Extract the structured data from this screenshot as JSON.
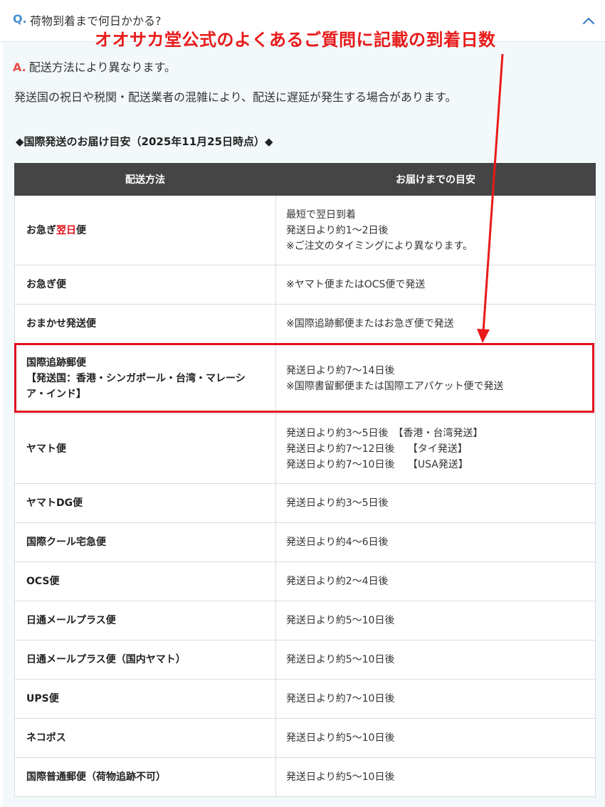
{
  "question": {
    "marker": "Q.",
    "text": "荷物到着まで何日かかる?",
    "toggle_icon": "chevron-up-icon"
  },
  "annotation": {
    "title": "オオサカ堂公式のよくあるご質問に記載の到着日数",
    "color": "#e81a1a"
  },
  "answer": {
    "marker": "A.",
    "text": "配送方法により異なります。",
    "note": "発送国の祝日や税関・配送業者の混雑により、配送に遅延が発生する場合があります。",
    "heading": "◆国際発送のお届け目安（2025年11月25日時点）◆"
  },
  "table": {
    "headers": [
      "配送方法",
      "お届けまでの目安"
    ],
    "rows": [
      {
        "method_parts": [
          "お急ぎ",
          "翌日",
          "便"
        ],
        "estimate": [
          "最短で翌日到着",
          "発送日より約1～2日後",
          "※ご注文のタイミングにより異なります。"
        ]
      },
      {
        "method": "お急ぎ便",
        "estimate": [
          "※ヤマト便またはOCS便で発送"
        ]
      },
      {
        "method": "おまかせ発送便",
        "estimate": [
          "※国際追跡郵便またはお急ぎ便で発送"
        ]
      },
      {
        "method": "国際追跡郵便",
        "method_sub": [
          "【発送国：香港・シンガポール・台湾・マレーシ",
          "ア・インド】"
        ],
        "estimate": [
          "発送日より約7～14日後",
          "※国際書留郵便または国際エアパケット便で発送"
        ],
        "highlighted": true
      },
      {
        "method": "ヤマト便",
        "estimate": [
          "発送日より約3～5日後　【香港・台湾発送】",
          "発送日より約7～12日後　 【タイ発送】",
          "発送日より約7～10日後　 【USA発送】"
        ]
      },
      {
        "method": "ヤマトDG便",
        "estimate": [
          "発送日より約3～5日後"
        ]
      },
      {
        "method": "国際クール宅急便",
        "estimate": [
          "発送日より約4～6日後"
        ]
      },
      {
        "method": "OCS便",
        "estimate": [
          "発送日より約2～4日後"
        ]
      },
      {
        "method": "日通メールプラス便",
        "estimate": [
          "発送日より約5～10日後"
        ]
      },
      {
        "method": "日通メールプラス便（国内ヤマト）",
        "estimate": [
          "発送日より約5～10日後"
        ]
      },
      {
        "method": "UPS便",
        "estimate": [
          "発送日より約7～10日後"
        ]
      },
      {
        "method": "ネコポス",
        "estimate": [
          "発送日より約5～10日後"
        ]
      },
      {
        "method": "国際普通郵便（荷物追跡不可）",
        "estimate": [
          "発送日より約5～10日後"
        ]
      }
    ]
  },
  "colors": {
    "q_marker": "#4a8fd0",
    "a_marker": "#ea4c4c",
    "header_bg": "#454545",
    "answer_bg": "#f3f9fb",
    "highlight": "#e01020"
  }
}
